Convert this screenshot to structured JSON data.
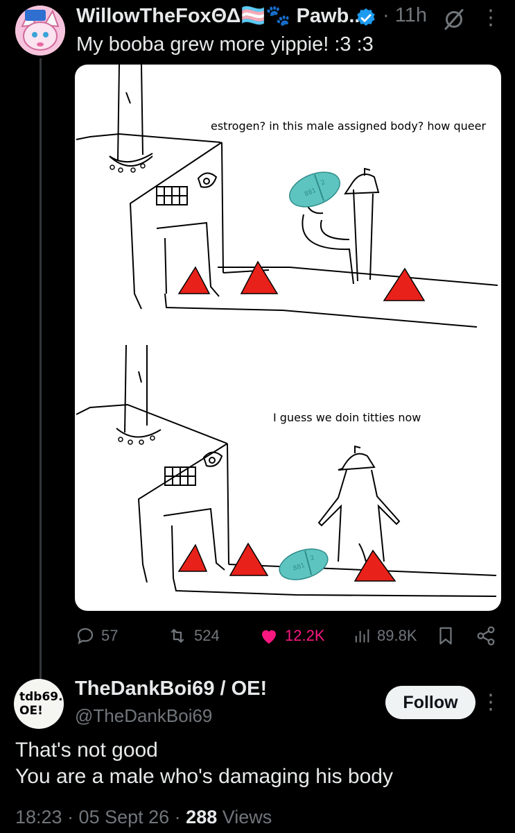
{
  "post": {
    "author_name": "WillowTheFoxΘΔ🏳️‍⚧️🐾 Pawb...",
    "time": "· 11h",
    "text": "My booba grew more yippie! :3 :3",
    "comic": {
      "panel1_caption": "estrogen? in this male assigned body? how queer",
      "panel2_caption": "I guess we doin titties now",
      "pill_marking": "881 2"
    },
    "actions": {
      "replies": "57",
      "reposts": "524",
      "likes": "12.2K",
      "views": "89.8K"
    },
    "colors": {
      "like": "#f91880",
      "verified": "#1d9bf0",
      "muted": "#71767b"
    }
  },
  "reply": {
    "avatar_text_line1": "tdb69.",
    "avatar_text_line2": "OE!",
    "author_name": "TheDankBoi69 / OE!",
    "handle": "@TheDankBoi69",
    "follow_label": "Follow",
    "text_line1": "That's not good",
    "text_line2": "You are a male who's damaging his body",
    "meta_time": "18:23 · 05 Sept 26 · ",
    "meta_views_count": "288",
    "meta_views_label": " Views"
  },
  "icons": [
    "reply-icon",
    "repost-icon",
    "like-icon",
    "views-icon",
    "bookmark-icon",
    "share-icon",
    "verified-icon",
    "grok-icon",
    "more-icon"
  ]
}
